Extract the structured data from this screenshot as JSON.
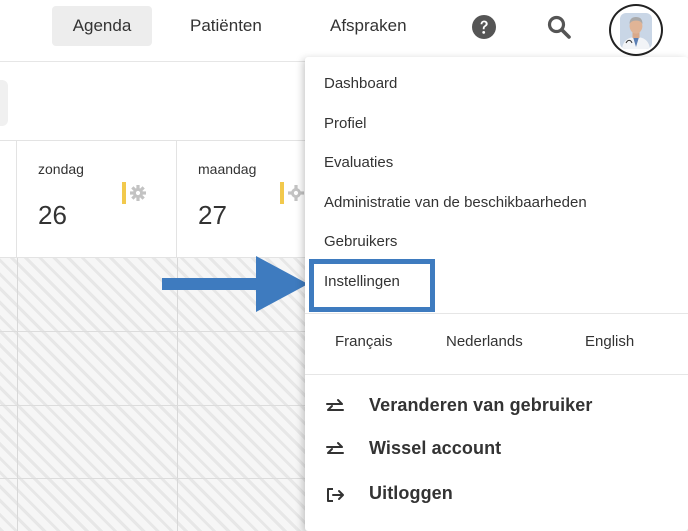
{
  "nav": {
    "items": [
      {
        "label": "Agenda",
        "active": true
      },
      {
        "label": "Patiënten"
      },
      {
        "label": "Afspraken"
      }
    ],
    "icons": [
      "help-icon",
      "search-icon",
      "user-avatar"
    ]
  },
  "calendar": {
    "days": [
      {
        "name": "zondag",
        "number": "26"
      },
      {
        "name": "maandag",
        "number": "27"
      }
    ]
  },
  "menu": {
    "items": [
      {
        "label": "Dashboard"
      },
      {
        "label": "Profiel"
      },
      {
        "label": "Evaluaties"
      },
      {
        "label": "Administratie van de beschikbaarheden"
      },
      {
        "label": "Gebruikers"
      },
      {
        "label": "Instellingen",
        "highlighted": true
      }
    ],
    "languages": [
      {
        "label": "Français"
      },
      {
        "label": "Nederlands"
      },
      {
        "label": "English"
      }
    ],
    "actions": [
      {
        "label": "Veranderen van gebruiker",
        "icon": "swap-icon"
      },
      {
        "label": "Wissel account",
        "icon": "swap-icon"
      },
      {
        "label": "Uitloggen",
        "icon": "logout-icon"
      }
    ]
  },
  "colors": {
    "highlight": "#3e7bbf",
    "arrow": "#3e7bbf",
    "gear_accent": "#f2c94c",
    "nav_active_bg": "#ededed"
  }
}
